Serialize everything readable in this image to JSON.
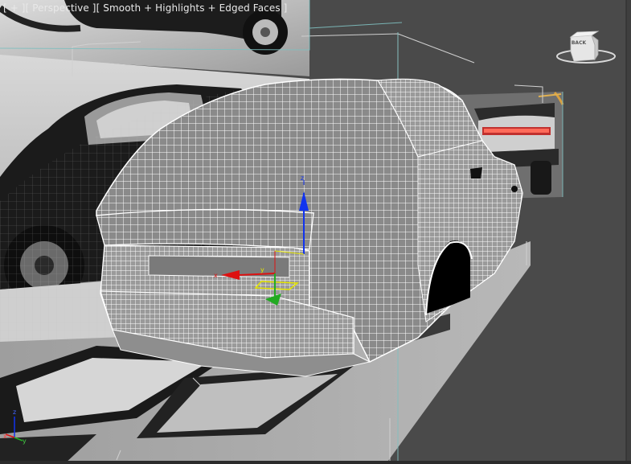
{
  "viewport": {
    "label_open": "[ ",
    "menu_plus": "+",
    "sep1": " ][ ",
    "menu_view": "Perspective",
    "sep2": " ][ ",
    "menu_shading": "Smooth + Highlights + Edged Faces",
    "label_close": " ]"
  },
  "viewcube": {
    "face_label": "BACK"
  },
  "axis_tripod": {
    "x": "x",
    "y": "y",
    "z": "z"
  },
  "colors": {
    "viewport_bg": "#4a4a4a",
    "wireframe": "#ffffff",
    "gizmo_x": "#dd1111",
    "gizmo_y": "#22aa22",
    "gizmo_z": "#1133ee",
    "gizmo_active": "#e6e600"
  },
  "icons": [
    "viewcube-icon",
    "transform-gizmo-icon",
    "axis-tripod-icon"
  ]
}
